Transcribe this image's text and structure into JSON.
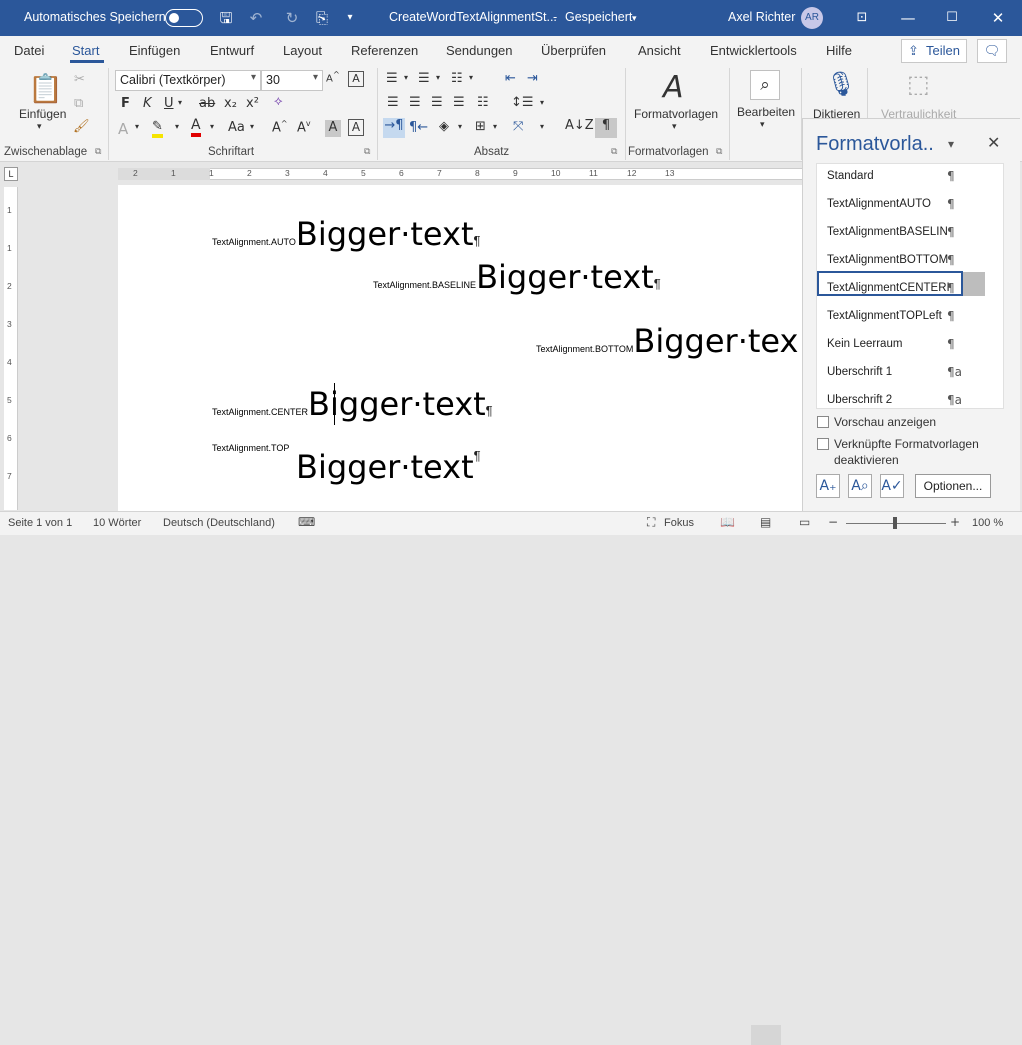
{
  "titlebar": {
    "autosave_label": "Automatisches Speichern",
    "doc_title": "CreateWordTextAlignmentSt...",
    "saved_state": "Gespeichert",
    "user_name": "Axel Richter",
    "user_initials": "AR",
    "bg_color": "#2b579a"
  },
  "tabs": [
    "Datei",
    "Start",
    "Einfügen",
    "Entwurf",
    "Layout",
    "Referenzen",
    "Sendungen",
    "Überprüfen",
    "Ansicht",
    "Entwicklertools",
    "Hilfe"
  ],
  "active_tab": "Start",
  "share_label": "Teilen",
  "ribbon": {
    "clipboard": {
      "paste_label": "Einfügen",
      "group_label": "Zwischenablage"
    },
    "font": {
      "name": "Calibri (Textkörper)",
      "size": "30",
      "group_label": "Schriftart"
    },
    "paragraph": {
      "group_label": "Absatz"
    },
    "styles": {
      "button_label": "Formatvorlagen",
      "group_label": "Formatvorlagen"
    },
    "editing": {
      "button_label": "Bearbeiten"
    },
    "dictate": {
      "button_label": "Diktieren"
    },
    "sensitivity": {
      "button_label": "Vertraulichkeit"
    }
  },
  "ruler": {
    "ticks": [
      "2",
      "1",
      "1",
      "2",
      "3",
      "4",
      "5",
      "6",
      "7",
      "8",
      "9",
      "10",
      "11",
      "12",
      "13"
    ],
    "vticks": [
      "1",
      "1",
      "2",
      "3",
      "4",
      "5",
      "6",
      "7"
    ]
  },
  "document": {
    "lines": [
      {
        "small": "TextAlignment.AUTO",
        "big": "Bigger·text",
        "mark": "¶"
      },
      {
        "small": "TextAlignment.BASELINE",
        "big": "Bigger·text",
        "mark": "¶"
      },
      {
        "small": "TextAlignment.BOTTOM",
        "big": "Bigger·tex",
        "mark": ""
      },
      {
        "small": "TextAlignment.CENTER",
        "big": "Bigger·text",
        "mark": "¶"
      },
      {
        "small": "TextAlignment.TOP",
        "big": "Bigger·text",
        "mark": "¶"
      }
    ]
  },
  "styles_pane": {
    "title": "Formatvorla..",
    "styles": [
      {
        "name": "Standard",
        "mark": "¶"
      },
      {
        "name": "TextAlignmentAUTO",
        "mark": "¶"
      },
      {
        "name": "TextAlignmentBASELIN",
        "mark": "¶"
      },
      {
        "name": "TextAlignmentBOTTOM",
        "mark": "¶"
      },
      {
        "name": "TextAlignmentCENTERI",
        "mark": "¶"
      },
      {
        "name": "TextAlignmentTOPLeft",
        "mark": "¶"
      },
      {
        "name": "Kein Leerraum",
        "mark": "¶"
      },
      {
        "name": "Überschrift 1",
        "mark": "¶a"
      },
      {
        "name": "Überschrift 2",
        "mark": "¶a"
      }
    ],
    "selected_style": "TextAlignmentCENTERI",
    "preview_label": "Vorschau anzeigen",
    "linked_label_1": "Verknüpfte Formatvorlagen",
    "linked_label_2": "deaktivieren",
    "options_label": "Optionen..."
  },
  "status": {
    "page": "Seite 1 von 1",
    "words": "10 Wörter",
    "language": "Deutsch (Deutschland)",
    "focus": "Fokus",
    "zoom": "100 %"
  }
}
